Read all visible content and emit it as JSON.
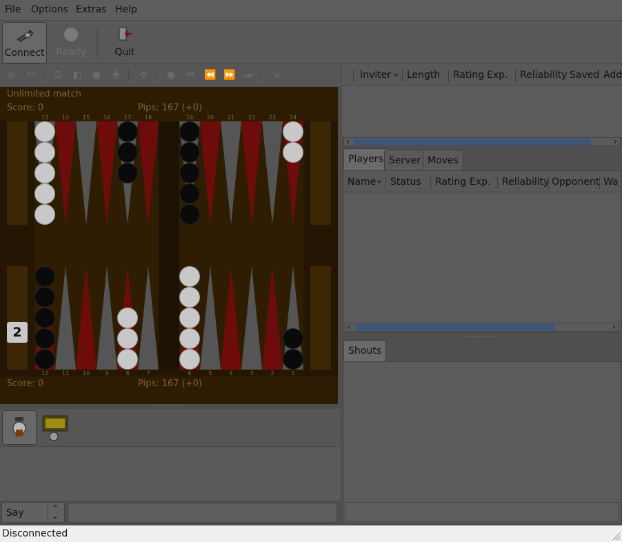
{
  "menubar": {
    "items": [
      "File",
      "Options",
      "Extras",
      "Help"
    ]
  },
  "toolbar": {
    "connect": "Connect",
    "ready": "Ready",
    "quit": "Quit"
  },
  "board": {
    "match_label": "Unlimited match",
    "top_score": "Score: 0",
    "top_pips": "Pips: 167 (+0)",
    "bottom_score": "Score: 0",
    "bottom_pips": "Pips: 167 (+0)",
    "cube_value": "2",
    "top_points_left": [
      "13",
      "14",
      "15",
      "16",
      "17",
      "18"
    ],
    "top_points_right": [
      "19",
      "20",
      "21",
      "22",
      "23",
      "24"
    ],
    "bottom_points_left": [
      "12",
      "11",
      "10",
      "9",
      "8",
      "7"
    ],
    "bottom_points_right": [
      "6",
      "5",
      "4",
      "3",
      "2",
      "1"
    ]
  },
  "invitations": {
    "columns": [
      "Inviter",
      "Length",
      "Rating",
      "Exp.",
      "Reliability",
      "Saved",
      "Add"
    ]
  },
  "tabs": {
    "items": [
      "Players",
      "Server",
      "Moves"
    ]
  },
  "players": {
    "columns": [
      "Name",
      "Status",
      "Rating",
      "Exp.",
      "Reliability",
      "Opponent",
      "Wa"
    ]
  },
  "shouts": {
    "tab": "Shouts"
  },
  "chat": {
    "mode": "Say"
  },
  "status": {
    "text": "Disconnected"
  }
}
